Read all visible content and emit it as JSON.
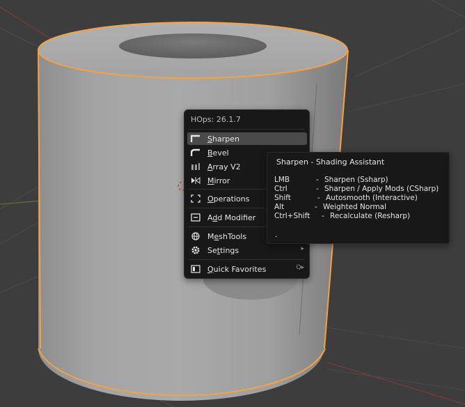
{
  "menu": {
    "title": "HOps: 26.1.7",
    "items": [
      {
        "label_pre": "",
        "label_u": "S",
        "label_post": "harpen",
        "icon": "sharpen-icon",
        "active": true
      },
      {
        "label_pre": "",
        "label_u": "B",
        "label_post": "evel",
        "icon": "bevel-icon"
      },
      {
        "label_pre": "",
        "label_u": "A",
        "label_post": "rray V2",
        "icon": "array-icon"
      },
      {
        "label_pre": "",
        "label_u": "M",
        "label_post": "irror",
        "icon": "mirror-icon"
      },
      {
        "label_pre": "",
        "label_u": "O",
        "label_post": "perations",
        "icon": "operations-icon"
      },
      {
        "label_pre": "A",
        "label_u": "d",
        "label_post": "d Modifier",
        "icon": "add-modifier-icon"
      },
      {
        "label_pre": "M",
        "label_u": "e",
        "label_post": "shTools",
        "icon": "meshtools-icon"
      },
      {
        "label_pre": "Se",
        "label_u": "t",
        "label_post": "tings",
        "icon": "settings-gear-icon",
        "submenu": "▸"
      },
      {
        "label_pre": "",
        "label_u": "Q",
        "label_post": "uick Favorites",
        "icon": "quick-favorites-icon",
        "shortcut": "Q▸"
      }
    ]
  },
  "tooltip": {
    "title": "Sharpen  - Shading Assistant",
    "rows": [
      {
        "key": "LMB",
        "sep": "-",
        "desc": "Sharpen (Ssharp)"
      },
      {
        "key": "Ctrl",
        "sep": "-",
        "desc": "Sharpen / Apply Mods (CSharp)"
      },
      {
        "key": "Shift",
        "sep": "-",
        "desc": "Autosmooth (Interactive)"
      },
      {
        "key": "Alt",
        "sep": "-",
        "desc": "Weighted Normal"
      },
      {
        "key": "Ctrl+Shift",
        "sep": "-",
        "desc": "Recalculate (Resharp)"
      }
    ],
    "footer": "."
  },
  "colors": {
    "viewport_bg": "#3d3d3d",
    "selection_outline": "#f5a33c",
    "menu_bg": "#181818",
    "menu_active": "#4a4a4a",
    "axis_x": "#c8463c",
    "axis_y": "#76a83c"
  }
}
